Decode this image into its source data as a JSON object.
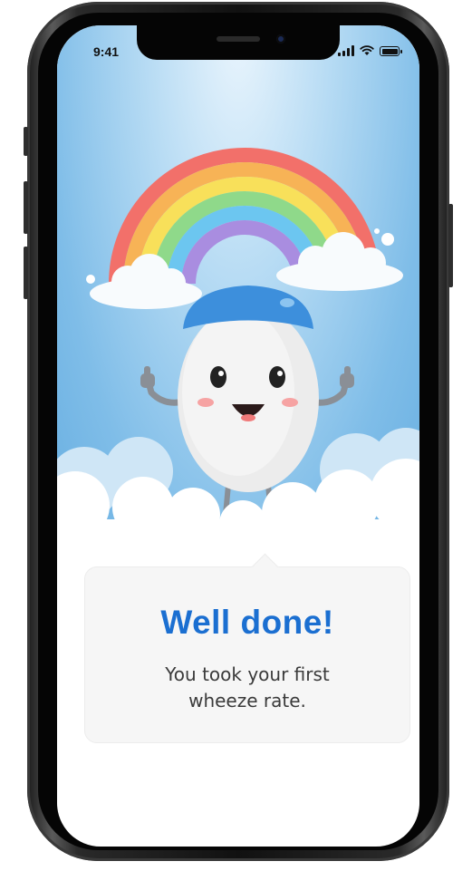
{
  "status_bar": {
    "time": "9:41",
    "icons": [
      "cellular-signal-icon",
      "wifi-icon",
      "battery-icon"
    ]
  },
  "illustration": {
    "scene": "rainbow-clouds-mascot",
    "colors": {
      "rainbow": [
        "#f2706a",
        "#f7b356",
        "#f8e05a",
        "#8fd98a",
        "#6cc6f0",
        "#a98de0"
      ],
      "sky": "#7fbde8",
      "mascot_body": "#eeeeee",
      "mascot_cap": "#3d8fdc",
      "cloud": "#ffffff"
    }
  },
  "message_card": {
    "title": "Well done!",
    "body_line1": "You took your first",
    "body_line2": "wheeze rate.",
    "title_color": "#1b6fd1"
  }
}
